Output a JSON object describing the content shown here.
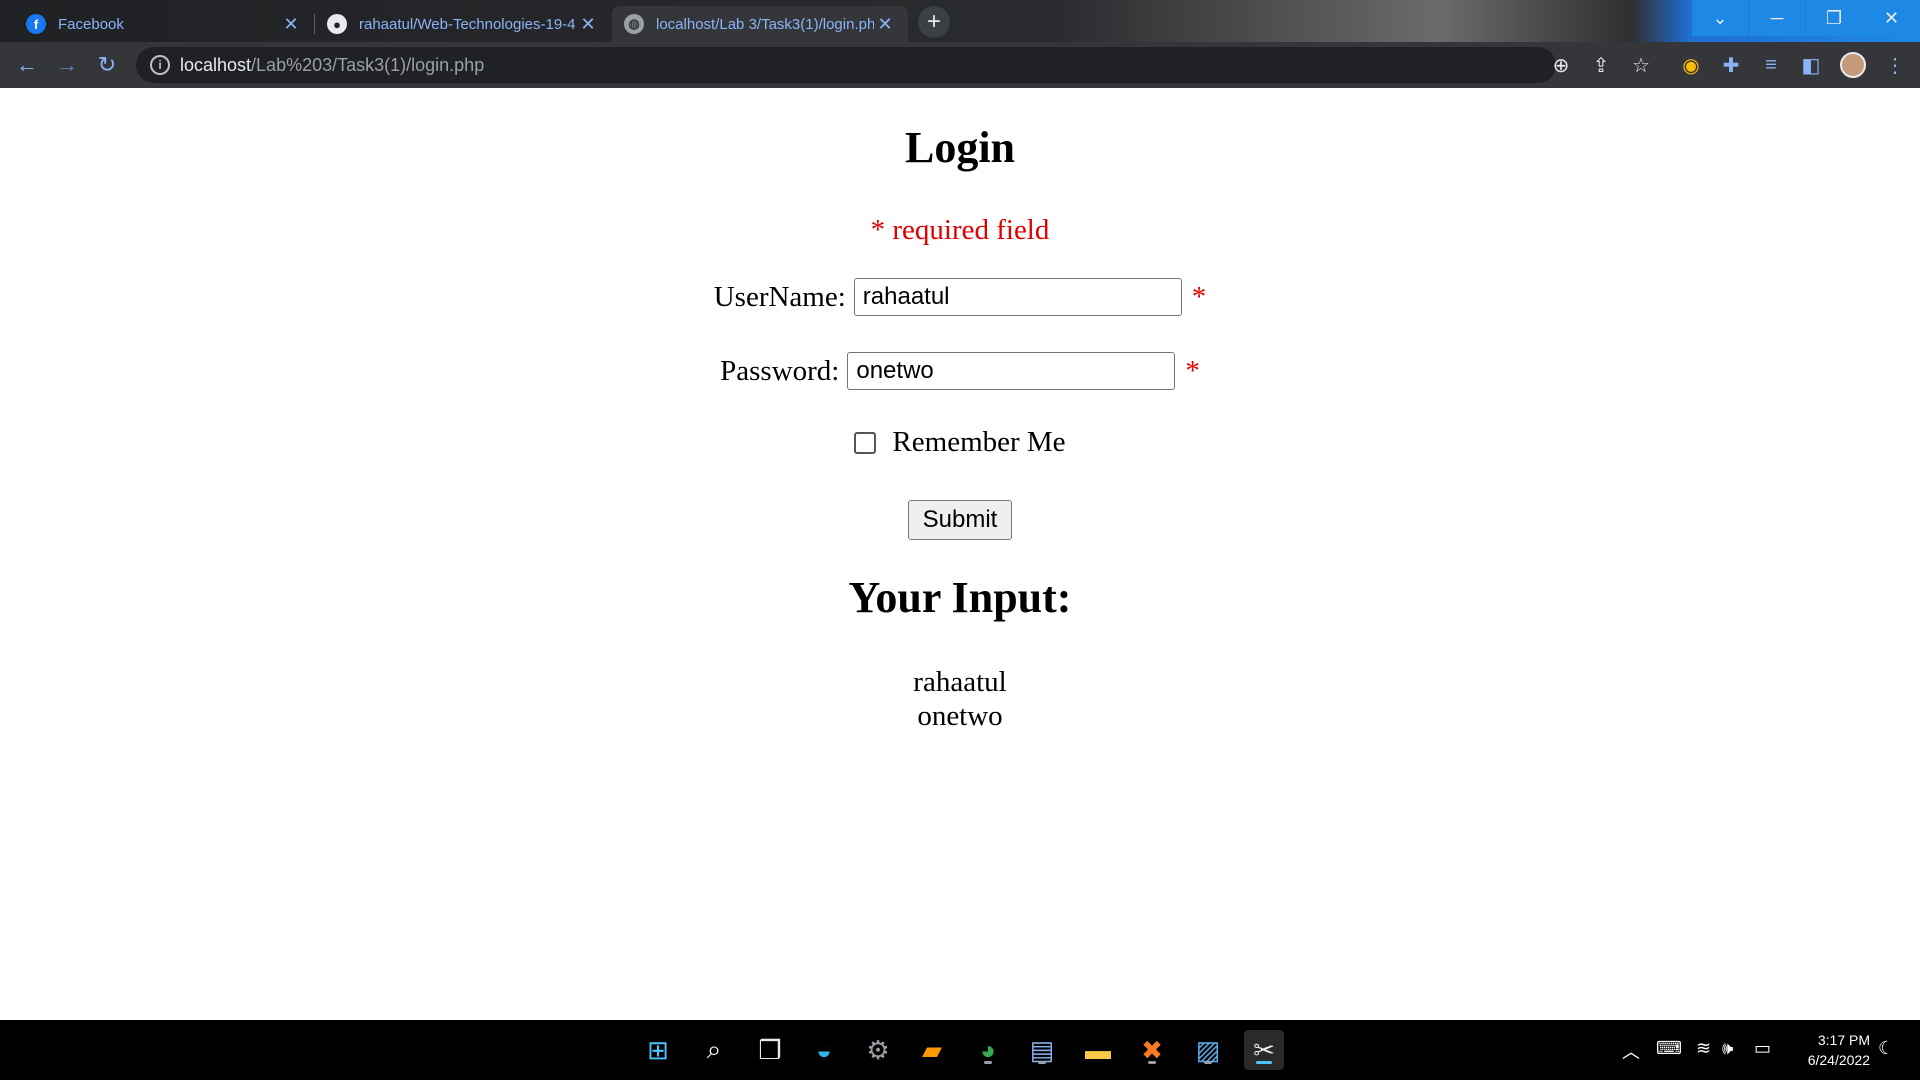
{
  "browser": {
    "tabs": [
      {
        "title": "Facebook",
        "favicon": "facebook-icon"
      },
      {
        "title": "rahaatul/Web-Technologies-19-4",
        "favicon": "github-icon"
      },
      {
        "title": "localhost/Lab 3/Task3(1)/login.php",
        "favicon": "globe-icon"
      }
    ],
    "address": {
      "host": "localhost",
      "path": "/Lab%203/Task3(1)/login.php"
    },
    "accent": "#1e88e5"
  },
  "page": {
    "title": "Login",
    "required_note": "* required field",
    "username_label": "UserName:",
    "username_value": "rahaatul",
    "password_label": "Password:",
    "password_value": "onetwo",
    "required_mark": "*",
    "remember_label": "Remember Me",
    "remember_checked": false,
    "submit_label": "Submit",
    "output_heading": "Your Input:",
    "output_lines": [
      "rahaatul",
      "onetwo"
    ]
  },
  "taskbar": {
    "time": "3:17 PM",
    "date": "6/24/2022"
  }
}
